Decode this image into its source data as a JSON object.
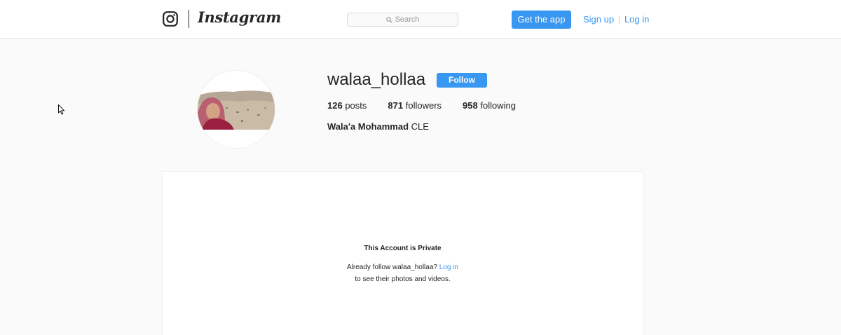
{
  "header": {
    "brand_name": "Instagram",
    "search_placeholder": "Search",
    "get_app_label": "Get the app",
    "signup_label": "Sign up",
    "separator": "|",
    "login_label": "Log in"
  },
  "profile": {
    "username": "walaa_hollaa",
    "follow_label": "Follow",
    "posts_count": "126",
    "posts_label": "posts",
    "followers_count": "871",
    "followers_label": "followers",
    "following_count": "958",
    "following_label": "following",
    "full_name": "Wala'a Mohammad",
    "bio": "CLE"
  },
  "private_notice": {
    "title": "This Account is Private",
    "line1_prefix": "Already follow walaa_hollaa?",
    "line1_link": "Log in",
    "line2": "to see their photos and videos."
  },
  "colors": {
    "accent": "#3897f0",
    "background": "#fafafa",
    "text": "#262626"
  },
  "icons": {
    "logo": "instagram-camera-icon",
    "search": "search-icon",
    "cursor": "mouse-cursor-icon"
  }
}
